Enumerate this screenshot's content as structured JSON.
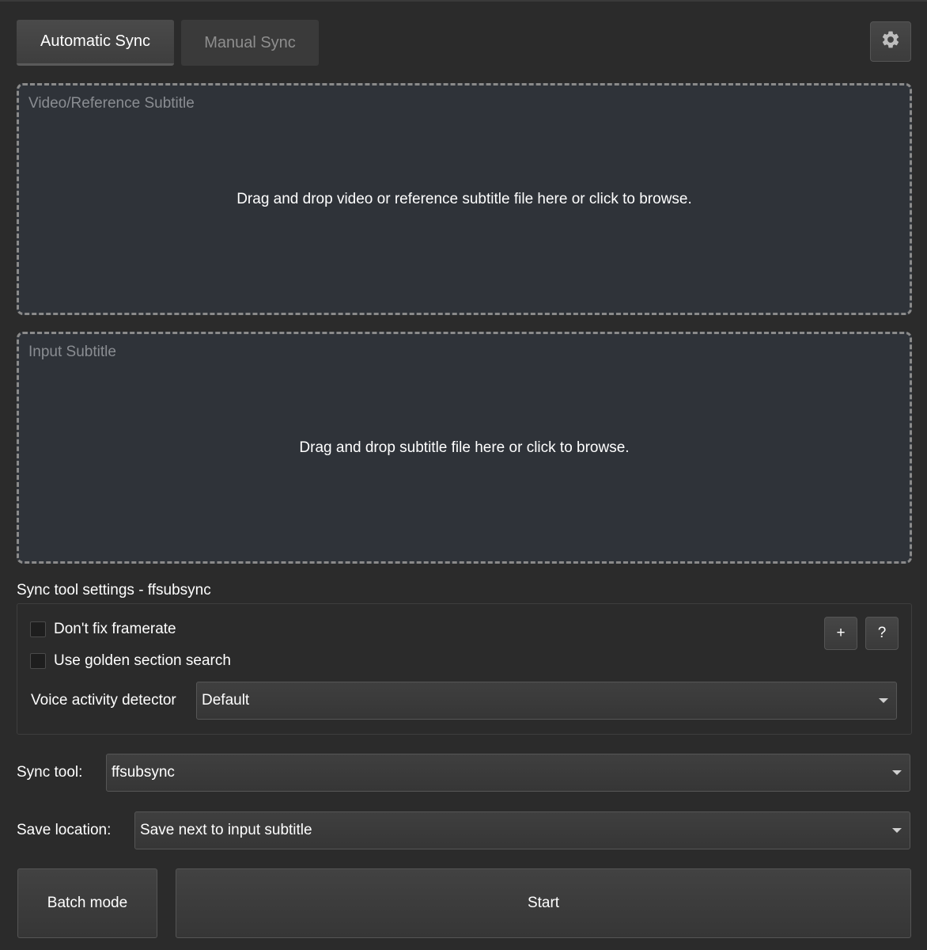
{
  "tabs": [
    {
      "label": "Automatic Sync",
      "active": true
    },
    {
      "label": "Manual Sync",
      "active": false
    }
  ],
  "settings_icon": "gear-icon",
  "dropzones": {
    "video": {
      "label": "Video/Reference Subtitle",
      "prompt": "Drag and drop video or reference subtitle file here or click to browse."
    },
    "input": {
      "label": "Input Subtitle",
      "prompt": "Drag and drop subtitle file here or click to browse."
    }
  },
  "sync_settings": {
    "title": "Sync tool settings - ffsubsync",
    "checkboxes": [
      {
        "label": "Don't fix framerate",
        "checked": false
      },
      {
        "label": "Use golden section search",
        "checked": false
      }
    ],
    "add_button": "+",
    "help_button": "?",
    "vad_label": "Voice activity detector",
    "vad_value": "Default"
  },
  "sync_tool": {
    "label": "Sync tool:",
    "value": "ffsubsync"
  },
  "save_location": {
    "label": "Save location:",
    "value": "Save next to input subtitle"
  },
  "buttons": {
    "batch": "Batch mode",
    "start": "Start"
  },
  "colors": {
    "background": "#2b2b2b",
    "dropzone": "#2f3339",
    "dashed_border": "#8a8a8a"
  }
}
